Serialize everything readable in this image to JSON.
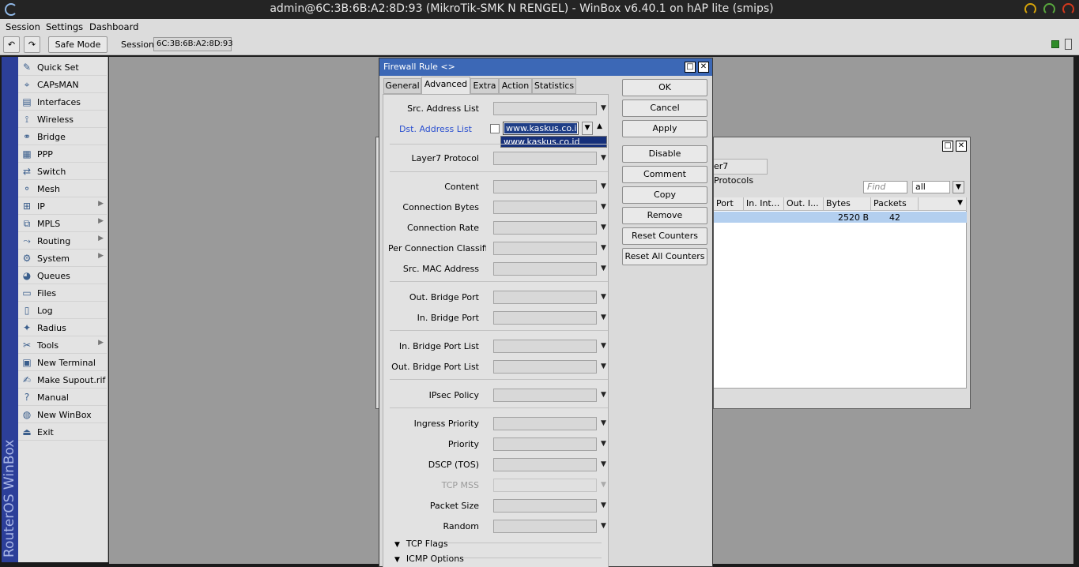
{
  "window": {
    "title": "admin@6C:3B:6B:A2:8D:93 (MikroTik-SMK N RENGEL) - WinBox v6.40.1 on hAP lite (smips)"
  },
  "menu": [
    "Session",
    "Settings",
    "Dashboard"
  ],
  "toolbar": {
    "undo_icon": "undo-icon",
    "redo_icon": "redo-icon",
    "safe_mode": "Safe Mode",
    "session_label": "Session",
    "session_value": "6C:3B:6B:A2:8D:93"
  },
  "brand": "RouterOS WinBox",
  "sidebar": [
    {
      "label": "Quick Set",
      "icon": "quick-set-icon",
      "glyph": "✎",
      "sub": false
    },
    {
      "label": "CAPsMAN",
      "icon": "capsman-icon",
      "glyph": "⌖",
      "sub": false
    },
    {
      "label": "Interfaces",
      "icon": "interfaces-icon",
      "glyph": "▤",
      "sub": false
    },
    {
      "label": "Wireless",
      "icon": "wireless-icon",
      "glyph": "⟟",
      "sub": false
    },
    {
      "label": "Bridge",
      "icon": "bridge-icon",
      "glyph": "⚭",
      "sub": false
    },
    {
      "label": "PPP",
      "icon": "ppp-icon",
      "glyph": "▦",
      "sub": false
    },
    {
      "label": "Switch",
      "icon": "switch-icon",
      "glyph": "⇄",
      "sub": false
    },
    {
      "label": "Mesh",
      "icon": "mesh-icon",
      "glyph": "⚬",
      "sub": false
    },
    {
      "label": "IP",
      "icon": "ip-icon",
      "glyph": "⊞",
      "sub": true
    },
    {
      "label": "MPLS",
      "icon": "mpls-icon",
      "glyph": "⧉",
      "sub": true
    },
    {
      "label": "Routing",
      "icon": "routing-icon",
      "glyph": "⤳",
      "sub": true
    },
    {
      "label": "System",
      "icon": "system-icon",
      "glyph": "⚙",
      "sub": true
    },
    {
      "label": "Queues",
      "icon": "queues-icon",
      "glyph": "◕",
      "sub": false
    },
    {
      "label": "Files",
      "icon": "files-icon",
      "glyph": "▭",
      "sub": false
    },
    {
      "label": "Log",
      "icon": "log-icon",
      "glyph": "▯",
      "sub": false
    },
    {
      "label": "Radius",
      "icon": "radius-icon",
      "glyph": "✦",
      "sub": false
    },
    {
      "label": "Tools",
      "icon": "tools-icon",
      "glyph": "✂",
      "sub": true
    },
    {
      "label": "New Terminal",
      "icon": "terminal-icon",
      "glyph": "▣",
      "sub": false
    },
    {
      "label": "Make Supout.rif",
      "icon": "supout-icon",
      "glyph": "✍",
      "sub": false
    },
    {
      "label": "Manual",
      "icon": "manual-icon",
      "glyph": "?",
      "sub": false
    },
    {
      "label": "New WinBox",
      "icon": "winbox-icon",
      "glyph": "◍",
      "sub": false
    },
    {
      "label": "Exit",
      "icon": "exit-icon",
      "glyph": "⏏",
      "sub": false
    }
  ],
  "bg_window": {
    "tab": "er7 Protocols",
    "find_placeholder": "Find",
    "filter": "all",
    "columns": [
      "Port",
      "In. Int...",
      "Out. I...",
      "Bytes",
      "Packets"
    ],
    "row": {
      "bytes": "2520 B",
      "packets": "42"
    }
  },
  "dialog": {
    "title": "Firewall Rule <>",
    "tabs": [
      "General",
      "Advanced",
      "Extra",
      "Action",
      "Statistics"
    ],
    "active_tab": "Advanced",
    "fields": {
      "src_address_list": "Src. Address List",
      "dst_address_list": "Dst. Address List",
      "dst_value": "www.kaskus.co.id",
      "dst_option": "www.kaskus.co.id",
      "layer7": "Layer7 Protocol",
      "content": "Content",
      "connection_bytes": "Connection Bytes",
      "connection_rate": "Connection Rate",
      "per_connection": "Per Connection Classifier",
      "src_mac": "Src. MAC Address",
      "out_bridge_port": "Out. Bridge Port",
      "in_bridge_port": "In. Bridge Port",
      "in_bridge_port_list": "In. Bridge Port List",
      "out_bridge_port_list": "Out. Bridge Port List",
      "ipsec_policy": "IPsec Policy",
      "ingress_priority": "Ingress Priority",
      "priority": "Priority",
      "dscp": "DSCP (TOS)",
      "tcp_mss": "TCP MSS",
      "packet_size": "Packet Size",
      "random": "Random"
    },
    "sections": {
      "tcp_flags": "TCP Flags",
      "icmp_options": "ICMP Options"
    },
    "buttons": [
      "OK",
      "Cancel",
      "Apply",
      "Disable",
      "Comment",
      "Copy",
      "Remove",
      "Reset Counters",
      "Reset All Counters"
    ]
  }
}
